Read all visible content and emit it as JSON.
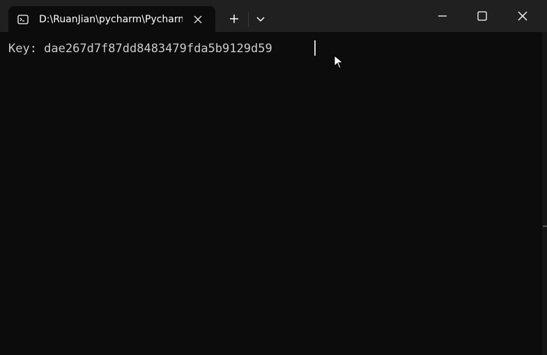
{
  "window": {
    "tab_title": "D:\\RuanJian\\pycharm\\Pycharm"
  },
  "icons": {
    "tab_app": "console-icon",
    "tab_close": "close-icon",
    "new_tab": "plus-icon",
    "tab_dropdown": "chevron-down-icon",
    "minimize": "minimize-icon",
    "maximize": "maximize-icon",
    "close": "close-icon",
    "pointer": "mouse-pointer-icon"
  },
  "terminal": {
    "output": "Key: dae267d7f87dd8483479fda5b9129d59"
  },
  "colors": {
    "titlebar": "#202020",
    "terminal_background": "#0c0c0c",
    "terminal_text": "#cccccc",
    "tab_title_text": "#ffffff"
  }
}
